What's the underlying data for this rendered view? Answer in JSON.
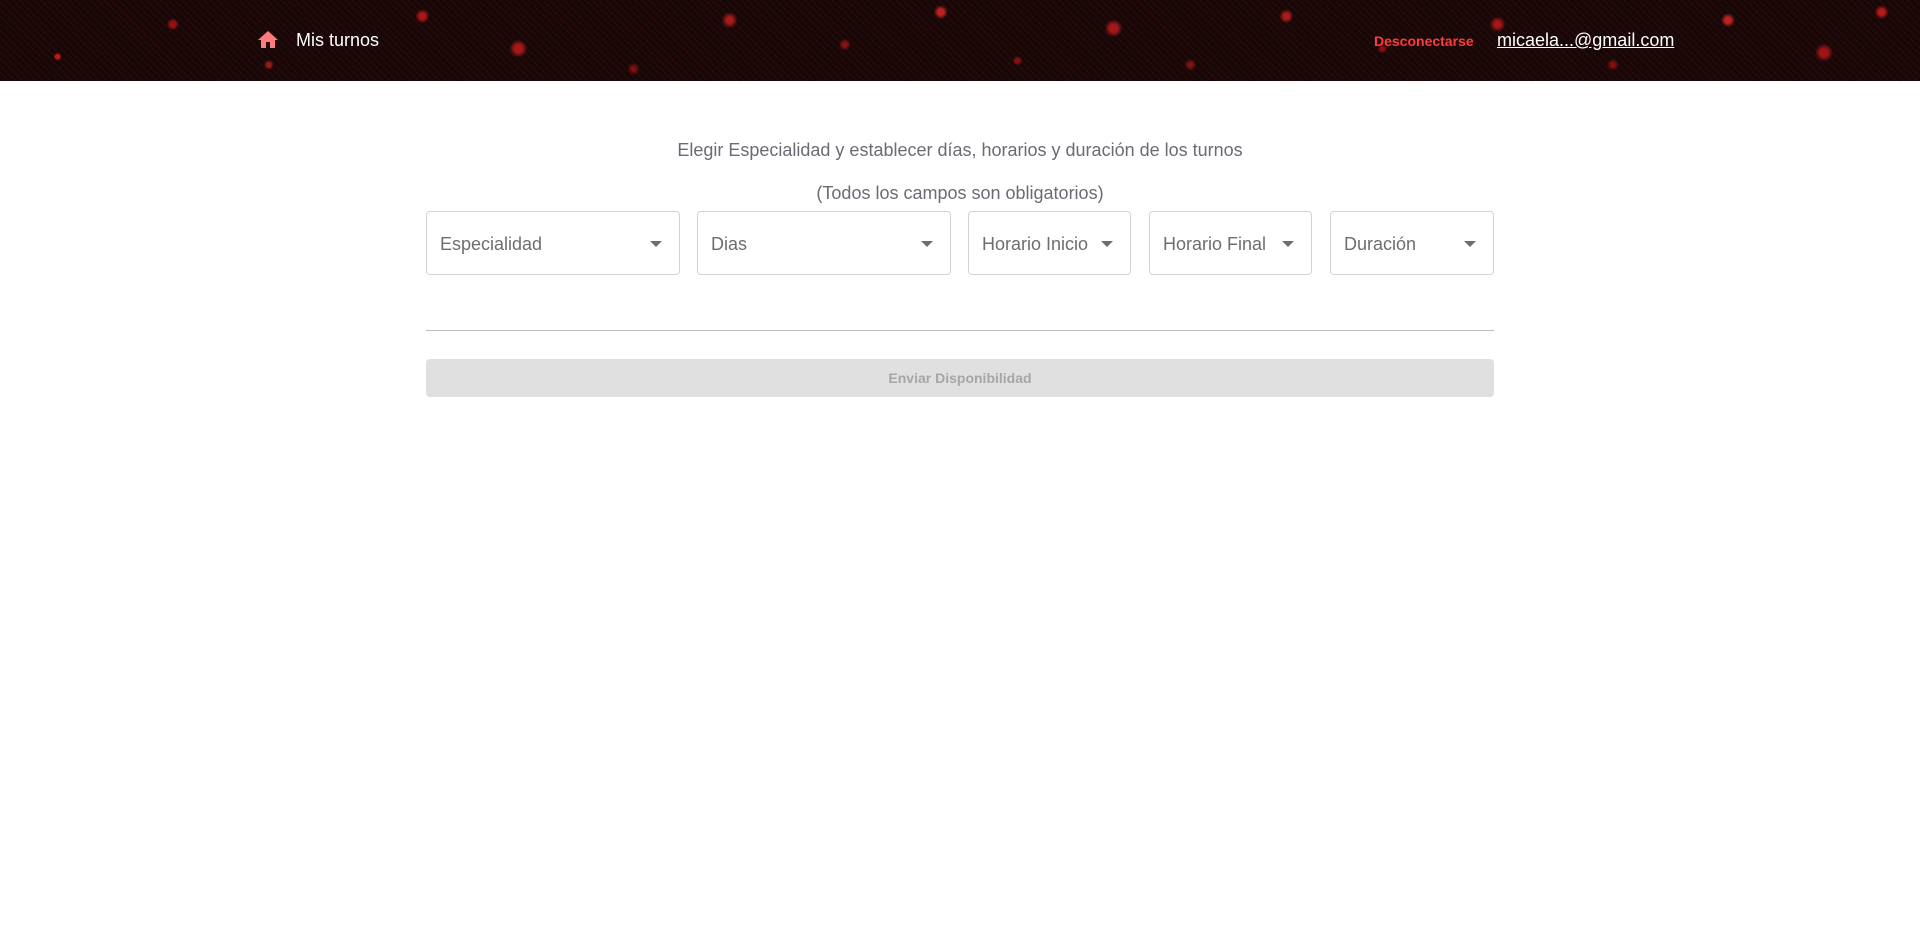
{
  "header": {
    "home_label": "Mis turnos",
    "logout_label": "Desconectarse",
    "user_email": "micaela...@gmail.com",
    "home_icon": "home-icon",
    "logout_color": "#ff3b3b"
  },
  "main": {
    "instruction": "Elegir Especialidad y establecer días, horarios y duración de los turnos",
    "required_note": "(Todos los campos son obligatorios)",
    "fields": {
      "especialidad": {
        "label": "Especialidad"
      },
      "dias": {
        "label": "Dias"
      },
      "horario_inicio": {
        "label": "Horario Inicio"
      },
      "horario_final": {
        "label": "Horario Final"
      },
      "duracion": {
        "label": "Duración"
      }
    },
    "submit_label": "Enviar Disponibilidad",
    "submit_disabled": true
  }
}
